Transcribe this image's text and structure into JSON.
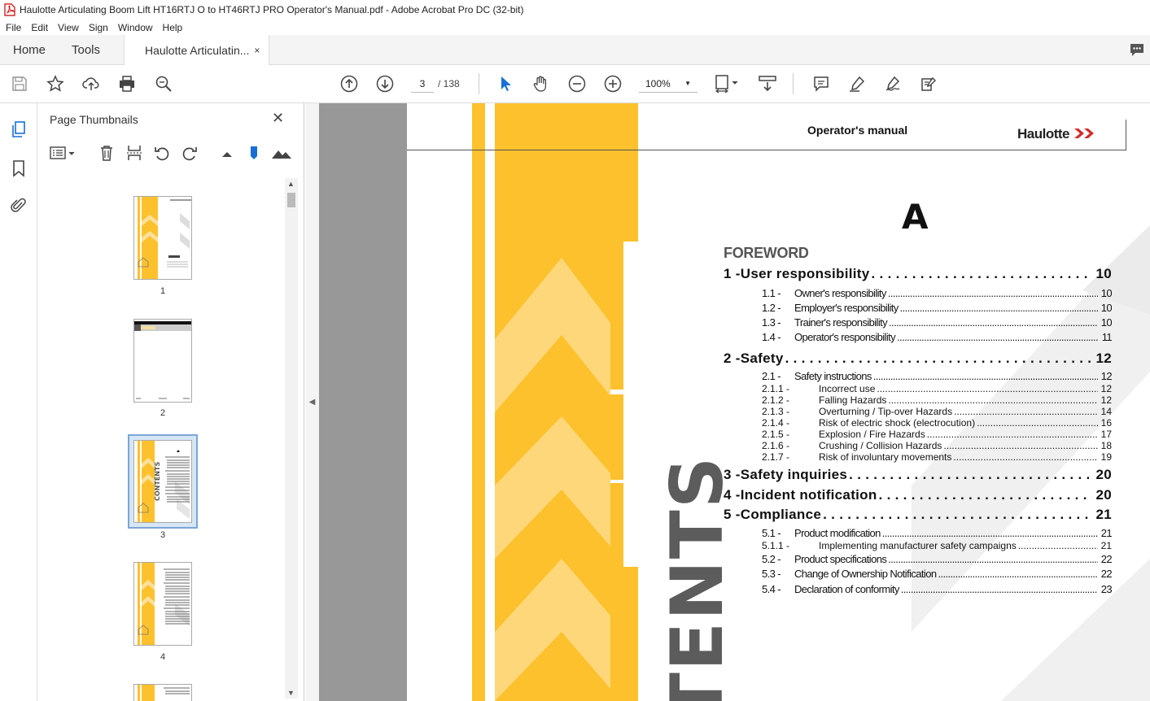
{
  "window": {
    "title": "Haulotte Articulating Boom Lift HT16RTJ O to HT46RTJ PRO Operator's Manual.pdf - Adobe Acrobat Pro DC (32-bit)"
  },
  "menu": [
    "File",
    "Edit",
    "View",
    "Sign",
    "Window",
    "Help"
  ],
  "tabs": {
    "home": "Home",
    "tools": "Tools",
    "document": "Haulotte Articulatin...",
    "close": "×"
  },
  "toolbar": {
    "current_page": "3",
    "page_total": "/ 138",
    "zoom": "100%"
  },
  "panel": {
    "title": "Page Thumbnails",
    "close": "✕",
    "thumbnails": [
      {
        "label": "1"
      },
      {
        "label": "2"
      },
      {
        "label": "3",
        "selected": true
      },
      {
        "label": "4"
      }
    ]
  },
  "page": {
    "header_title": "Operator's manual",
    "brand": "Haulotte",
    "section_letter": "A",
    "vertical_word": "TENTS",
    "foreword": "FOREWORD",
    "accent": "#fcc12c",
    "toc": [
      {
        "level": 1,
        "num": "1 - ",
        "text": "User responsibility",
        "page": "10"
      },
      {
        "level": 2,
        "num": "1.1 -",
        "text": "Owner's responsibility",
        "page": "10"
      },
      {
        "level": 2,
        "num": "1.2 -",
        "text": "Employer's responsibility",
        "page": "10"
      },
      {
        "level": 2,
        "num": "1.3 -",
        "text": "Trainer's responsibility",
        "page": "10"
      },
      {
        "level": 2,
        "num": "1.4 -",
        "text": "Operator's responsibility",
        "page": "11"
      },
      {
        "level": 1,
        "num": "2 - ",
        "text": "Safety",
        "page": "12"
      },
      {
        "level": 2,
        "num": "2.1 -",
        "text": "Safety instructions",
        "page": "12"
      },
      {
        "level": 3,
        "num": "2.1.1 -",
        "text": "Incorrect use",
        "page": "12"
      },
      {
        "level": 3,
        "num": "2.1.2 -",
        "text": "Falling Hazards",
        "page": "12"
      },
      {
        "level": 3,
        "num": "2.1.3 -",
        "text": "Overturning / Tip-over Hazards",
        "page": "14"
      },
      {
        "level": 3,
        "num": "2.1.4 -",
        "text": "Risk of electric shock (electrocution)",
        "page": "16"
      },
      {
        "level": 3,
        "num": "2.1.5 -",
        "text": "Explosion / Fire Hazards",
        "page": "17"
      },
      {
        "level": 3,
        "num": "2.1.6 -",
        "text": "Crushing / Collision Hazards",
        "page": "18"
      },
      {
        "level": 3,
        "num": "2.1.7 -",
        "text": "Risk of involuntary movements",
        "page": "19"
      },
      {
        "level": 1,
        "num": "3 - ",
        "text": "Safety inquiries",
        "page": "20"
      },
      {
        "level": 1,
        "num": "4 - ",
        "text": "Incident notification",
        "page": "20"
      },
      {
        "level": 1,
        "num": "5 - ",
        "text": "Compliance",
        "page": "21"
      },
      {
        "level": 2,
        "num": "5.1 -",
        "text": "Product modification",
        "page": "21"
      },
      {
        "level": 3,
        "num": "5.1.1 -",
        "text": "Implementing manufacturer safety campaigns",
        "page": "21"
      },
      {
        "level": 2,
        "num": "5.2 -",
        "text": "Product specifications",
        "page": "22"
      },
      {
        "level": 2,
        "num": "5.3 -",
        "text": "Change of Ownership Notification",
        "page": "22"
      },
      {
        "level": 2,
        "num": "5.4 -",
        "text": "Declaration of conformity",
        "page": "23"
      }
    ]
  }
}
